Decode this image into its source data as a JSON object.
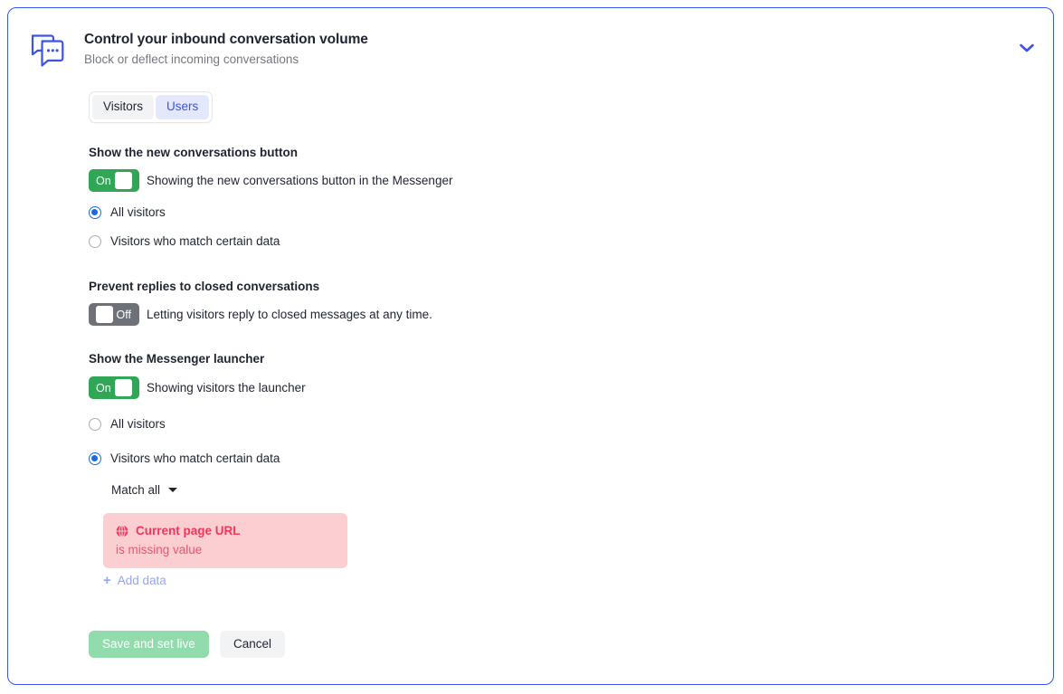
{
  "header": {
    "icon": "speech-bubbles-icon",
    "title": "Control your inbound conversation volume",
    "subtitle": "Block or deflect incoming conversations",
    "collapse_icon": "chevron-down-icon"
  },
  "tabs": [
    {
      "label": "Visitors",
      "active": false
    },
    {
      "label": "Users",
      "active": true
    }
  ],
  "sections": {
    "new_conversations": {
      "title": "Show the new conversations button",
      "toggle": {
        "state": "On",
        "label": "On"
      },
      "toggle_description": "Showing the new conversations button in the Messenger",
      "options": [
        {
          "label": "All visitors",
          "selected": true
        },
        {
          "label": "Visitors who match certain data",
          "selected": false
        }
      ]
    },
    "prevent_replies": {
      "title": "Prevent replies to closed conversations",
      "toggle": {
        "state": "Off",
        "label": "Off"
      },
      "toggle_description": "Letting visitors reply to closed messages at any time."
    },
    "messenger_launcher": {
      "title": "Show the Messenger launcher",
      "toggle": {
        "state": "On",
        "label": "On"
      },
      "toggle_description": "Showing visitors the launcher",
      "options": [
        {
          "label": "All visitors",
          "selected": false
        },
        {
          "label": "Visitors who match certain data",
          "selected": true
        }
      ],
      "match_select": {
        "value": "Match all",
        "icon": "caret-down-icon"
      },
      "data_rule": {
        "icon": "globe-error-icon",
        "attribute": "Current page URL",
        "condition": "is missing value"
      },
      "add_data_label": "Add data",
      "add_data_icon": "plus-icon"
    }
  },
  "footer": {
    "save_label": "Save and set live",
    "cancel_label": "Cancel"
  },
  "colors": {
    "card_border": "#3b53e8",
    "accent_blue": "#3b53e8",
    "toggle_on": "#31a656",
    "toggle_off": "#6e7278",
    "radio_checked": "#1b6ae0",
    "error_bg": "#fbcfd2",
    "error_text": "#f2365a",
    "primary_button": "#92dbac",
    "tab_active_bg": "#e4e8fd"
  }
}
